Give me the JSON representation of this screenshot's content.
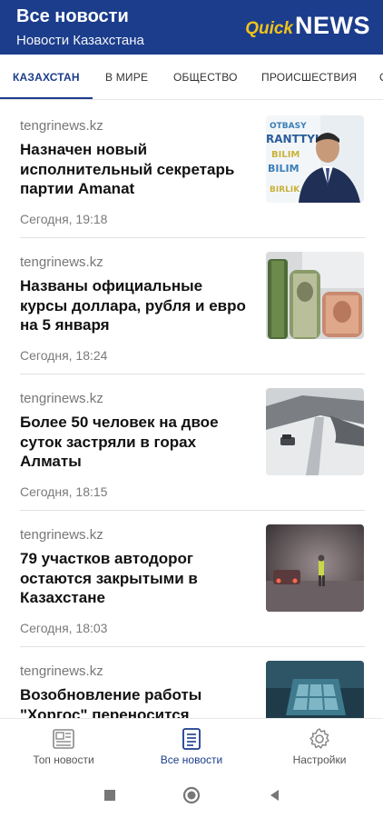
{
  "header": {
    "title": "Все новости",
    "subtitle": "Новости Казахстана",
    "brand_quick": "Quick",
    "brand_news": "NEWS"
  },
  "tabs": [
    {
      "label": "КАЗАХСТАН",
      "active": true
    },
    {
      "label": "В МИРЕ",
      "active": false
    },
    {
      "label": "ОБЩЕСТВО",
      "active": false
    },
    {
      "label": "ПРОИСШЕСТВИЯ",
      "active": false
    }
  ],
  "news": [
    {
      "source": "tengrinews.kz",
      "headline": "Назначен новый исполнительный секретарь партии Amanat",
      "time": "Сегодня, 19:18",
      "thumb": "portrait-man"
    },
    {
      "source": "tengrinews.kz",
      "headline": "Названы официальные курсы доллара, рубля и евро на 5 января",
      "time": "Сегодня, 18:24",
      "thumb": "banknotes"
    },
    {
      "source": "tengrinews.kz",
      "headline": "Более 50 человек на двое суток застряли в горах Алматы",
      "time": "Сегодня, 18:15",
      "thumb": "snowy-mountain-road"
    },
    {
      "source": "tengrinews.kz",
      "headline": "79 участков автодорог остаются закрытыми в Казахстане",
      "time": "Сегодня, 18:03",
      "thumb": "blizzard-road"
    },
    {
      "source": "tengrinews.kz",
      "headline": "Возобновление работы \"Хоргос\" переносится",
      "time": "",
      "thumb": "border-checkpoint"
    }
  ],
  "bottom_nav": [
    {
      "label": "Топ новости",
      "icon": "newspaper-icon",
      "active": false
    },
    {
      "label": "Все новости",
      "icon": "document-icon",
      "active": true
    },
    {
      "label": "Настройки",
      "icon": "gear-icon",
      "active": false
    }
  ],
  "colors": {
    "primary": "#1b3d8c",
    "brand_accent": "#f2c21a"
  }
}
